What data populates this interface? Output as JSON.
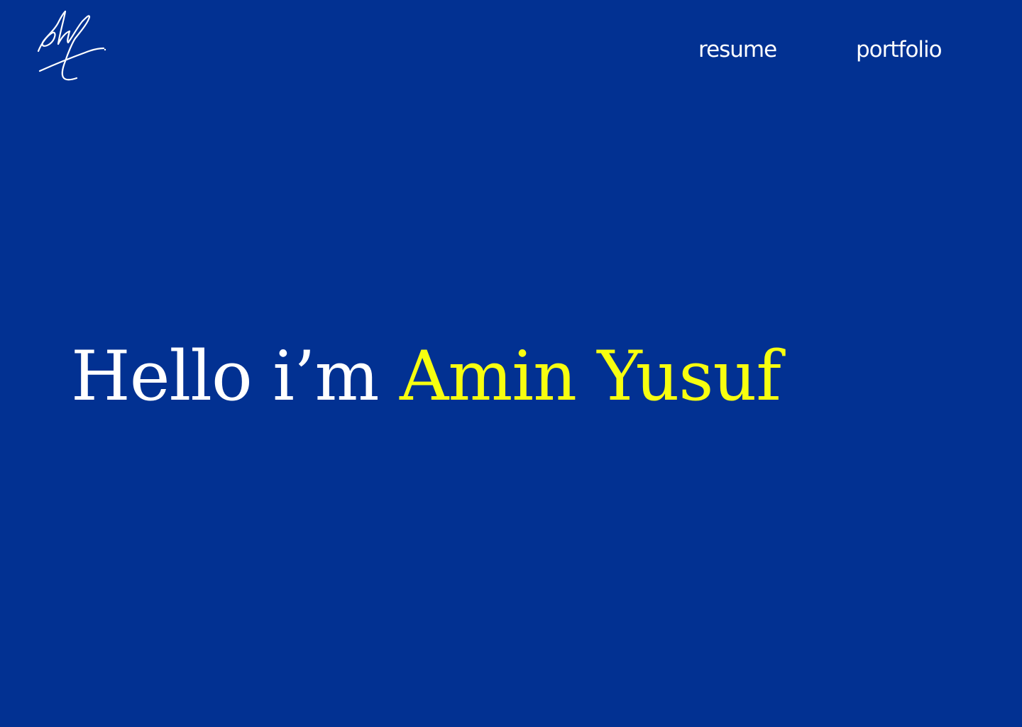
{
  "colors": {
    "background": "#023192",
    "text": "#ffffff",
    "accent": "#f7ff0f"
  },
  "logo": {
    "icon": "signature-logo-icon"
  },
  "nav": {
    "items": [
      {
        "label": "resume"
      },
      {
        "label": "portfolio"
      }
    ]
  },
  "hero": {
    "greeting": "Hello i’m",
    "name": "Amin Yusuf"
  }
}
